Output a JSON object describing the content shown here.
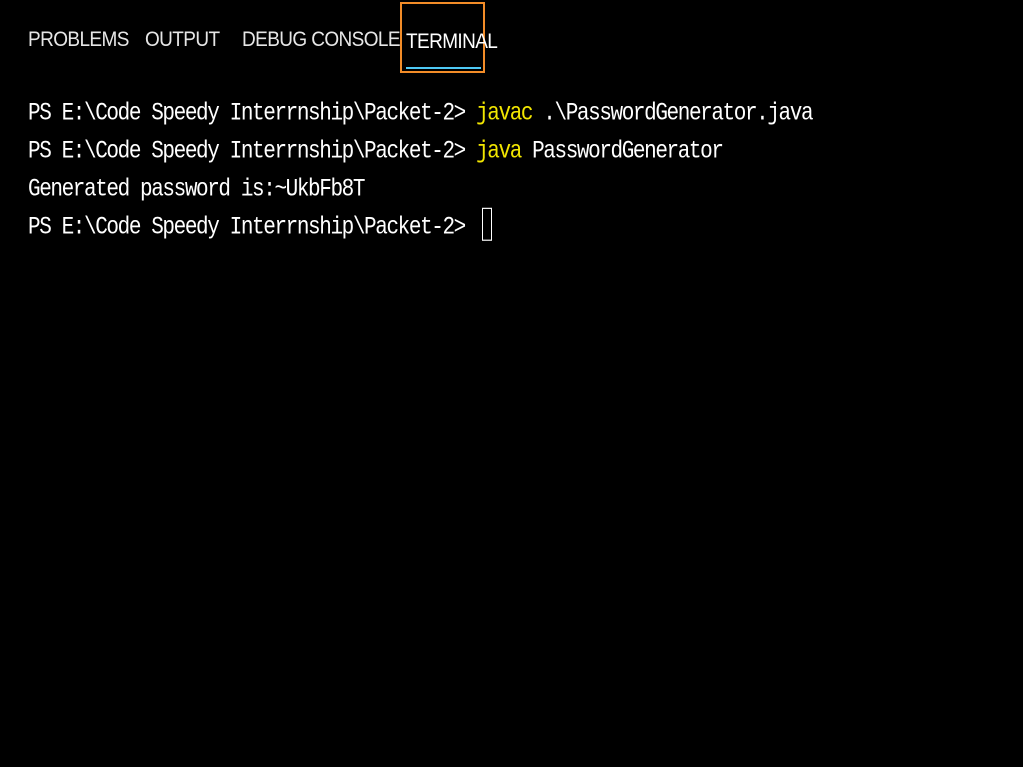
{
  "tabs": {
    "problems": "PROBLEMS",
    "output": "OUTPUT",
    "debug_console": "DEBUG CONSOLE",
    "terminal": "TERMINAL",
    "active": "TERMINAL"
  },
  "terminal": {
    "lines": [
      {
        "prompt": "PS E:\\Code Speedy Interrnship\\Packet-2> ",
        "command": "javac",
        "args": " .\\PasswordGenerator.java"
      },
      {
        "prompt": "PS E:\\Code Speedy Interrnship\\Packet-2> ",
        "command": "java",
        "args": " PasswordGenerator"
      },
      {
        "output": "Generated password is:~UkbFb8T"
      },
      {
        "prompt": "PS E:\\Code Speedy Interrnship\\Packet-2> "
      }
    ]
  },
  "colors": {
    "background": "#000000",
    "text": "#ffffff",
    "command": "#f2e600",
    "active_tab_border": "#f28c28",
    "active_tab_underline": "#4ec9f5"
  }
}
